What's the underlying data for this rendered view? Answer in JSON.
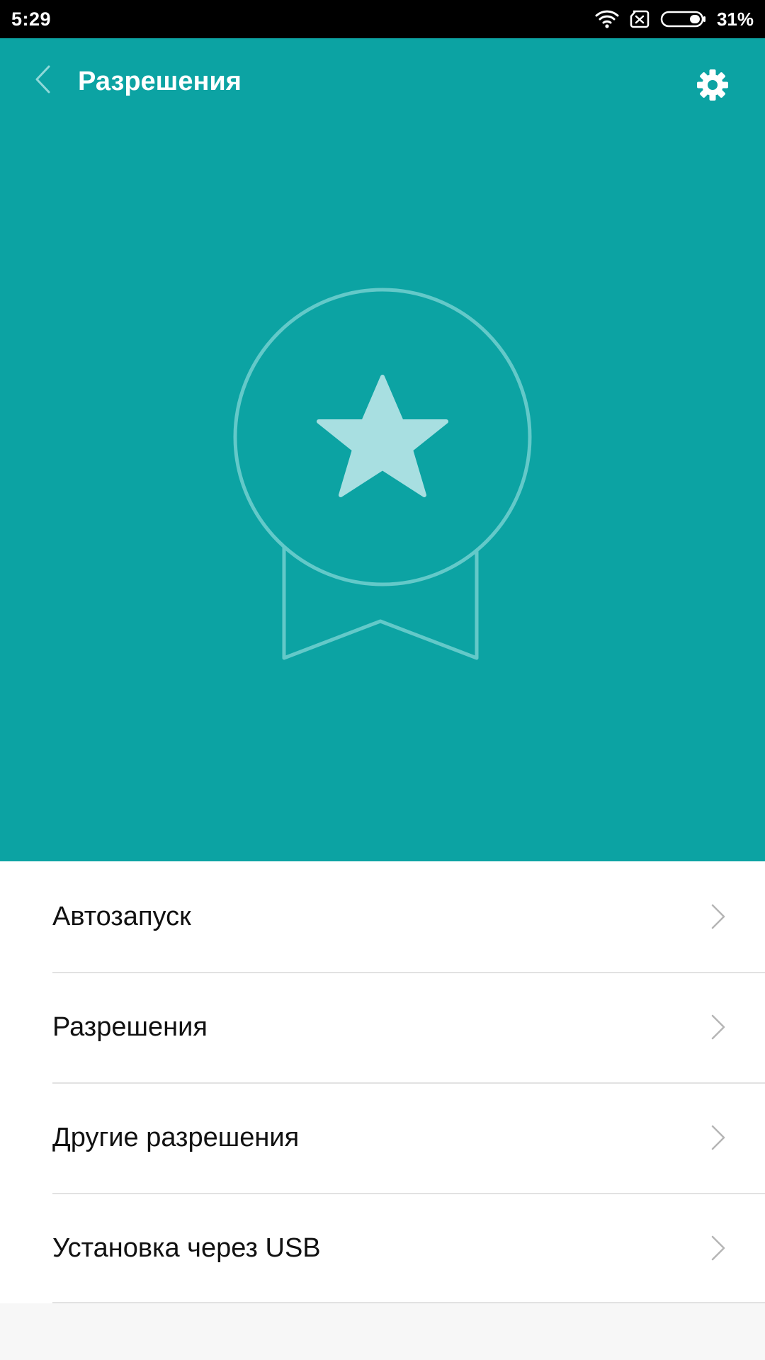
{
  "status_bar": {
    "time": "5:29",
    "battery_percent": "31%",
    "battery_level": 0.31,
    "icons": [
      "wifi-icon",
      "sim-missing-icon",
      "battery-icon"
    ]
  },
  "header": {
    "title": "Разрешения",
    "back_icon": "chevron-left-icon",
    "settings_icon": "gear-icon"
  },
  "hero": {
    "illustration": "award-badge-icon",
    "background_color": "#0ca3a3"
  },
  "menu": {
    "items": [
      {
        "label": "Автозапуск"
      },
      {
        "label": "Разрешения"
      },
      {
        "label": "Другие разрешения"
      },
      {
        "label": "Установка через USB"
      }
    ]
  }
}
